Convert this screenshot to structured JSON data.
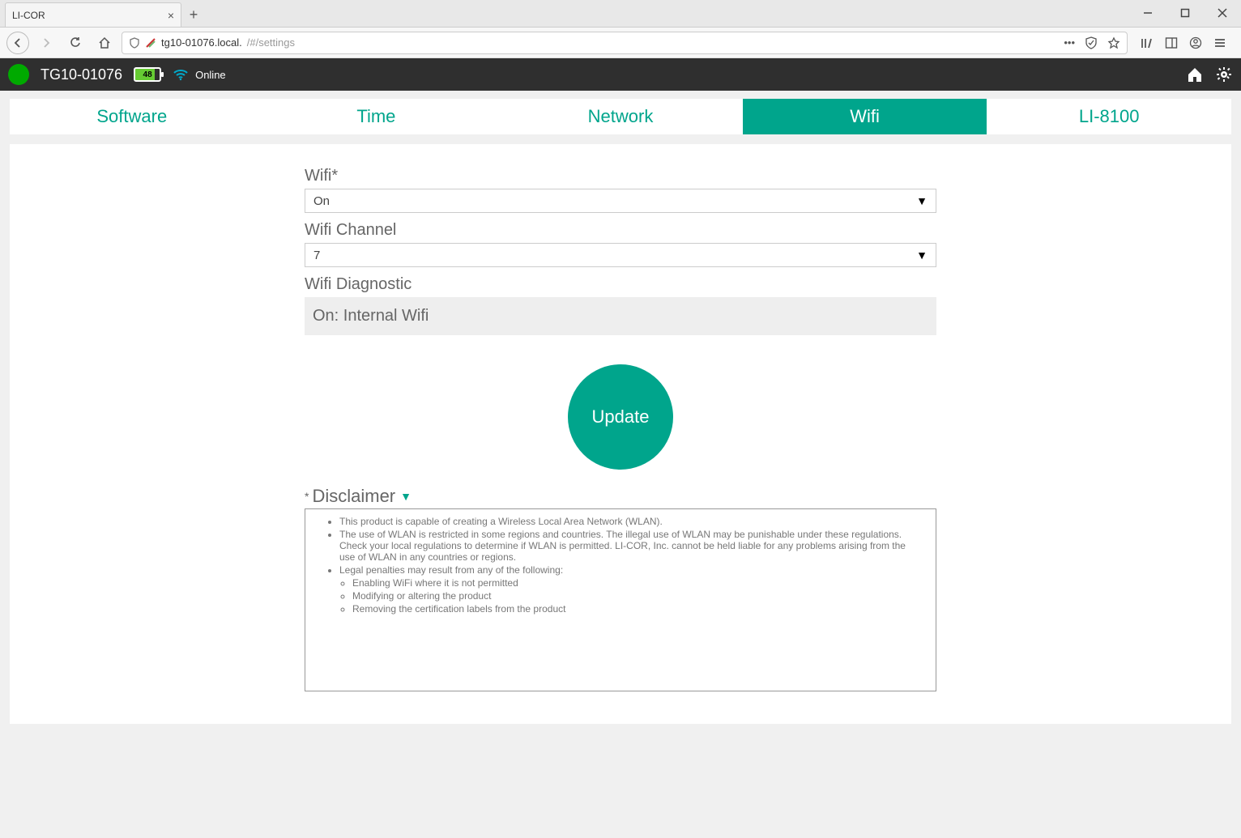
{
  "browser": {
    "tab_title": "LI-COR",
    "url_host": "tg10-01076.local.",
    "url_path": "/#/settings"
  },
  "header": {
    "device_name": "TG10-01076",
    "battery_pct": "48",
    "connection_status": "Online"
  },
  "tabs": [
    {
      "label": "Software"
    },
    {
      "label": "Time"
    },
    {
      "label": "Network"
    },
    {
      "label": "Wifi",
      "active": true
    },
    {
      "label": "LI-8100"
    }
  ],
  "form": {
    "wifi_label": "Wifi*",
    "wifi_value": "On",
    "channel_label": "Wifi Channel",
    "channel_value": "7",
    "diagnostic_label": "Wifi Diagnostic",
    "diagnostic_value": "On: Internal Wifi",
    "update_button": "Update"
  },
  "disclaimer": {
    "heading": "Disclaimer",
    "items": [
      "This product is capable of creating a Wireless Local Area Network (WLAN).",
      "The use of WLAN is restricted in some regions and countries. The illegal use of WLAN may be punishable under these regulations. Check your local regulations to determine if WLAN is permitted. LI-COR, Inc. cannot be held liable for any problems arising from the use of WLAN in any countries or regions.",
      "Legal penalties may result from any of the following:"
    ],
    "sub_items": [
      "Enabling WiFi where it is not permitted",
      "Modifying or altering the product",
      "Removing the certification labels from the product"
    ]
  }
}
